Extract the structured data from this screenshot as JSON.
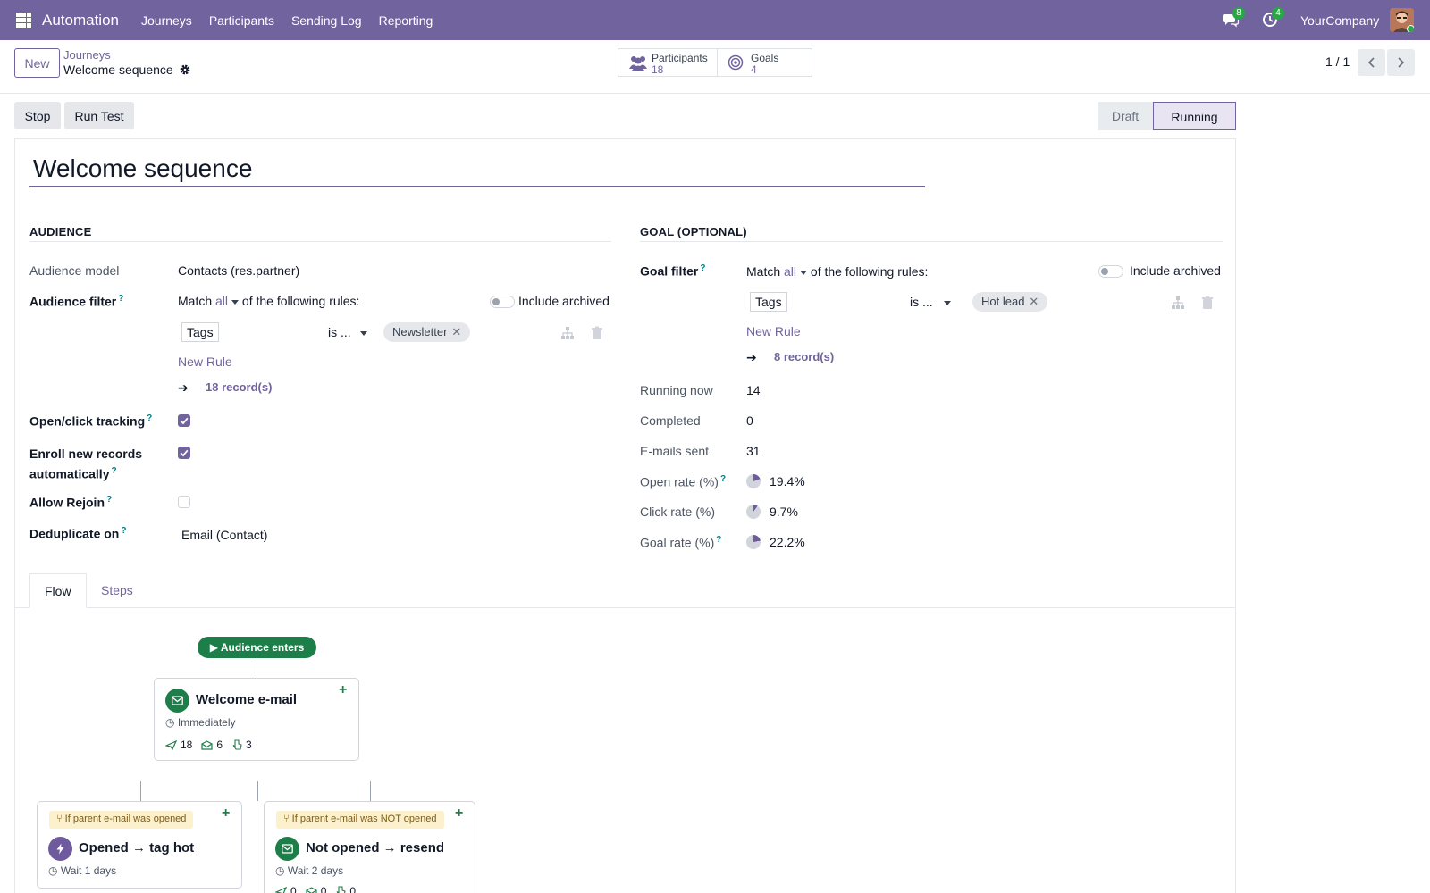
{
  "navbar": {
    "app_name": "Automation",
    "menu": [
      "Journeys",
      "Participants",
      "Sending Log",
      "Reporting"
    ],
    "messages_badge": "8",
    "activities_badge": "4",
    "company": "YourCompany"
  },
  "control_panel": {
    "new_label": "New",
    "breadcrumb_parent": "Journeys",
    "record_title": "Welcome sequence",
    "smart_buttons": [
      {
        "label": "Participants",
        "value": "18",
        "icon": "users-icon"
      },
      {
        "label": "Goals",
        "value": "4",
        "icon": "target-icon"
      }
    ],
    "pager": "1 / 1"
  },
  "actions": {
    "stop_label": "Stop",
    "run_test_label": "Run Test"
  },
  "status": {
    "stages": [
      "Draft",
      "Running"
    ],
    "current": "Running"
  },
  "form": {
    "name": "Welcome sequence",
    "audience": {
      "section_title": "AUDIENCE",
      "model_label": "Audience model",
      "model_value": "Contacts (res.partner)",
      "filter_label": "Audience filter",
      "match_prefix": "Match",
      "match_mode": "all",
      "match_suffix": "of the following rules:",
      "include_archived": "Include archived",
      "rule_field": "Tags",
      "rule_operator": "is ...",
      "rule_value": "Newsletter",
      "new_rule": "New Rule",
      "records": "18 record(s)",
      "tracking_label": "Open/click tracking",
      "tracking": true,
      "enroll_label_1": "Enroll new records",
      "enroll_label_2": "automatically",
      "enroll": true,
      "rejoin_label": "Allow Rejoin",
      "rejoin": false,
      "dedup_label": "Deduplicate on",
      "dedup_value": "Email (Contact)"
    },
    "goal": {
      "section_title": "GOAL (OPTIONAL)",
      "filter_label": "Goal filter",
      "match_prefix": "Match",
      "match_mode": "all",
      "match_suffix": "of the following rules:",
      "include_archived": "Include archived",
      "rule_field": "Tags",
      "rule_operator": "is ...",
      "rule_value": "Hot lead",
      "new_rule": "New Rule",
      "records": "8 record(s)",
      "stats": [
        {
          "label": "Running now",
          "value": "14"
        },
        {
          "label": "Completed",
          "value": "0"
        },
        {
          "label": "E-mails sent",
          "value": "31"
        }
      ],
      "rates": [
        {
          "label": "Open rate (%)",
          "value": "19.4%",
          "percent": 19.4,
          "help": true
        },
        {
          "label": "Click rate (%)",
          "value": "9.7%",
          "percent": 9.7,
          "help": false
        },
        {
          "label": "Goal rate (%)",
          "value": "22.2%",
          "percent": 22.2,
          "help": true
        }
      ]
    }
  },
  "tabs": [
    "Flow",
    "Steps"
  ],
  "flow": {
    "start_label": "Audience enters",
    "root": {
      "title": "Welcome e-mail",
      "timing": "Immediately",
      "sent": "18",
      "opened": "6",
      "clicked": "3"
    },
    "children": [
      {
        "condition": "If parent e-mail was opened",
        "title": "Opened → tag hot",
        "timing": "Wait 1 days"
      },
      {
        "condition": "If parent e-mail was NOT opened",
        "title": "Not opened → resend",
        "timing": "Wait 2 days",
        "sent": "0",
        "opened": "0",
        "clicked": "0"
      }
    ]
  }
}
